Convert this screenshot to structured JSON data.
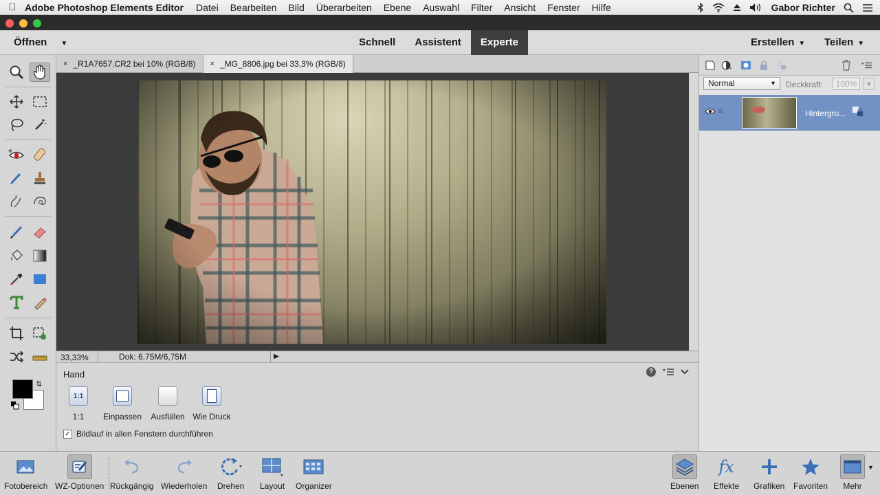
{
  "menubar": {
    "app_name": "Adobe Photoshop Elements Editor",
    "items": [
      "Datei",
      "Bearbeiten",
      "Bild",
      "Überarbeiten",
      "Ebene",
      "Auswahl",
      "Filter",
      "Ansicht",
      "Fenster",
      "Hilfe"
    ],
    "user": "Gabor Richter"
  },
  "topbar": {
    "open_label": "Öffnen",
    "modes": [
      "Schnell",
      "Assistent",
      "Experte"
    ],
    "active_mode": "Experte",
    "create_label": "Erstellen",
    "share_label": "Teilen"
  },
  "tabs": [
    {
      "close": "×",
      "title": "_R1A7657.CR2 bei 10% (RGB/8)"
    },
    {
      "close": "×",
      "title": "_MG_8806.jpg bei 33,3% (RGB/8)"
    }
  ],
  "status": {
    "zoom": "33,33%",
    "doc": "Dok: 6,75M/6,75M"
  },
  "tool_options": {
    "title": "Hand",
    "buttons": [
      {
        "icon_text": "1:1",
        "label": "1:1"
      },
      {
        "icon_text": "",
        "label": "Einpassen"
      },
      {
        "icon_text": "",
        "label": "Ausfüllen"
      },
      {
        "icon_text": "",
        "label": "Wie Druck"
      }
    ],
    "checkbox_label": "Bildlauf in allen Fenstern durchführen",
    "checkbox_checked": true
  },
  "layers_panel": {
    "blend_mode": "Normal",
    "opacity_label": "Deckkraft:",
    "opacity_value": "100%",
    "layer_name": "Hintergru..."
  },
  "bottombar": {
    "buttons": [
      {
        "label": "Fotobereich",
        "icon": "photo-bin-icon"
      },
      {
        "label": "WZ-Optionen",
        "icon": "tool-options-icon"
      },
      {
        "label": "Rückgängig",
        "icon": "undo-icon"
      },
      {
        "label": "Wiederholen",
        "icon": "redo-icon"
      },
      {
        "label": "Drehen",
        "icon": "rotate-icon"
      },
      {
        "label": "Layout",
        "icon": "layout-icon"
      },
      {
        "label": "Organizer",
        "icon": "organizer-icon"
      },
      {
        "label": "Ebenen",
        "icon": "layers-icon"
      },
      {
        "label": "Effekte",
        "icon": "fx-icon"
      },
      {
        "label": "Grafiken",
        "icon": "plus-icon"
      },
      {
        "label": "Favoriten",
        "icon": "star-icon"
      },
      {
        "label": "Mehr",
        "icon": "more-icon"
      }
    ],
    "effects_glyph": "fx"
  },
  "colors": {
    "accent_blue": "#4a7bd0",
    "selected_layer": "#7392c4",
    "active_mode_bg": "#3e3e3e"
  }
}
